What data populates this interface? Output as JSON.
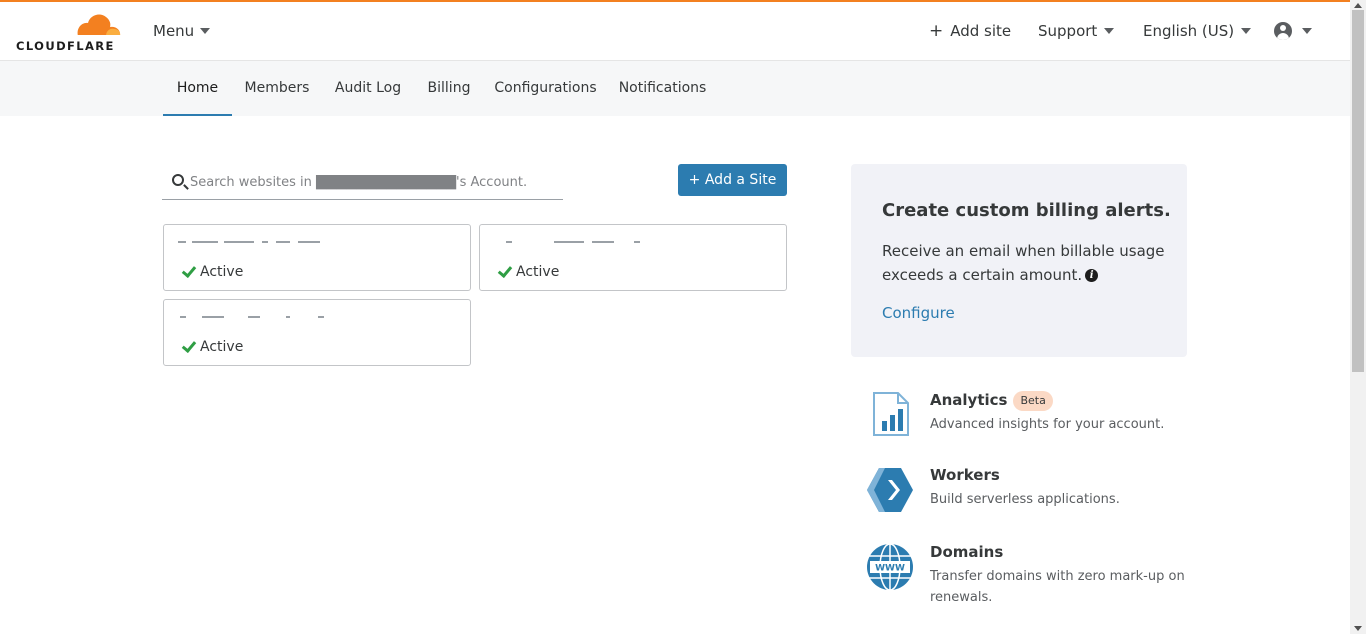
{
  "brand": {
    "wordmark": "CLOUDFLARE",
    "accent": "#f38020",
    "link_color": "#2c7cb0"
  },
  "header": {
    "menu_label": "Menu",
    "add_site_label": "Add site",
    "support_label": "Support",
    "language_label": "English (US)"
  },
  "tabs": [
    "Home",
    "Members",
    "Audit Log",
    "Billing",
    "Configurations",
    "Notifications"
  ],
  "active_tab": "Home",
  "search": {
    "placeholder": "Search websites in ██████████████'s Account."
  },
  "add_site_button": "+ Add a Site",
  "sites": [
    {
      "status": "Active"
    },
    {
      "status": "Active"
    },
    {
      "status": "Active"
    }
  ],
  "billing_alert": {
    "title": "Create custom billing alerts.",
    "body": "Receive an email when billable usage exceeds a certain amount.",
    "link": "Configure"
  },
  "products": [
    {
      "name": "Analytics",
      "badge": "Beta",
      "description": "Advanced insights for your account.",
      "icon": "analytics-icon"
    },
    {
      "name": "Workers",
      "description": "Build serverless applications.",
      "icon": "workers-icon"
    },
    {
      "name": "Domains",
      "description": "Transfer domains with zero mark-up on renewals.",
      "icon": "domains-globe-icon"
    }
  ]
}
